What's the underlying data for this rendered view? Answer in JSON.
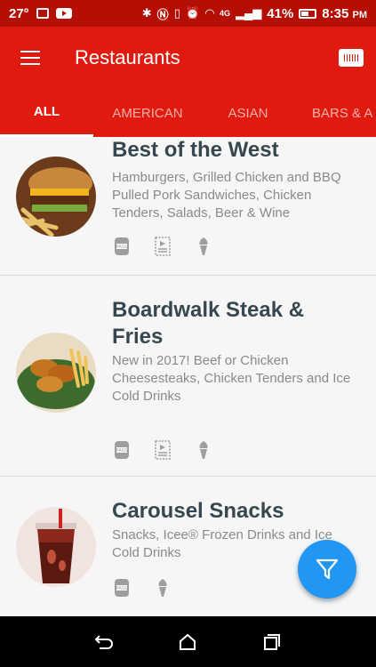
{
  "status_bar": {
    "temperature": "27°",
    "battery_percent": "41%",
    "time": "8:35",
    "ampm": "PM",
    "network": "4G"
  },
  "app_bar": {
    "title": "Restaurants",
    "menu_icon": "hamburger-menu-icon",
    "action_icon": "ticket-icon"
  },
  "tabs": [
    {
      "label": "ALL",
      "active": true
    },
    {
      "label": "AMERICAN",
      "active": false
    },
    {
      "label": "ASIAN",
      "active": false
    },
    {
      "label": "BARS & A",
      "active": false
    }
  ],
  "restaurants": [
    {
      "name": "Best of the West",
      "description": "Hamburgers, Grilled Chicken and BBQ Pulled Pork Sandwiches, Chicken Tenders, Salads, Beer & Wine",
      "image": "burger-and-fries-photo",
      "feature_icons": [
        "dining-pass-icon",
        "mobile-order-icon",
        "ice-cream-icon"
      ]
    },
    {
      "name": "Boardwalk Steak & Fries",
      "description": "New in 2017! Beef or Chicken Cheesesteaks, Chicken Tenders and Ice Cold Drinks",
      "image": "chicken-tenders-and-fries-photo",
      "feature_icons": [
        "dining-pass-icon",
        "mobile-order-icon",
        "ice-cream-icon"
      ]
    },
    {
      "name": "Carousel Snacks",
      "description": "Snacks, Icee® Frozen Drinks and Ice Cold Drinks",
      "image": "soda-cup-photo",
      "feature_icons": [
        "dining-pass-icon",
        "ice-cream-icon"
      ]
    }
  ],
  "fab": {
    "icon": "filter-icon"
  },
  "colors": {
    "primary": "#e01a0e",
    "status_bar": "#b50f05",
    "title_text": "#37474f",
    "description_text": "#8a8a8a",
    "fab": "#2196f3"
  }
}
